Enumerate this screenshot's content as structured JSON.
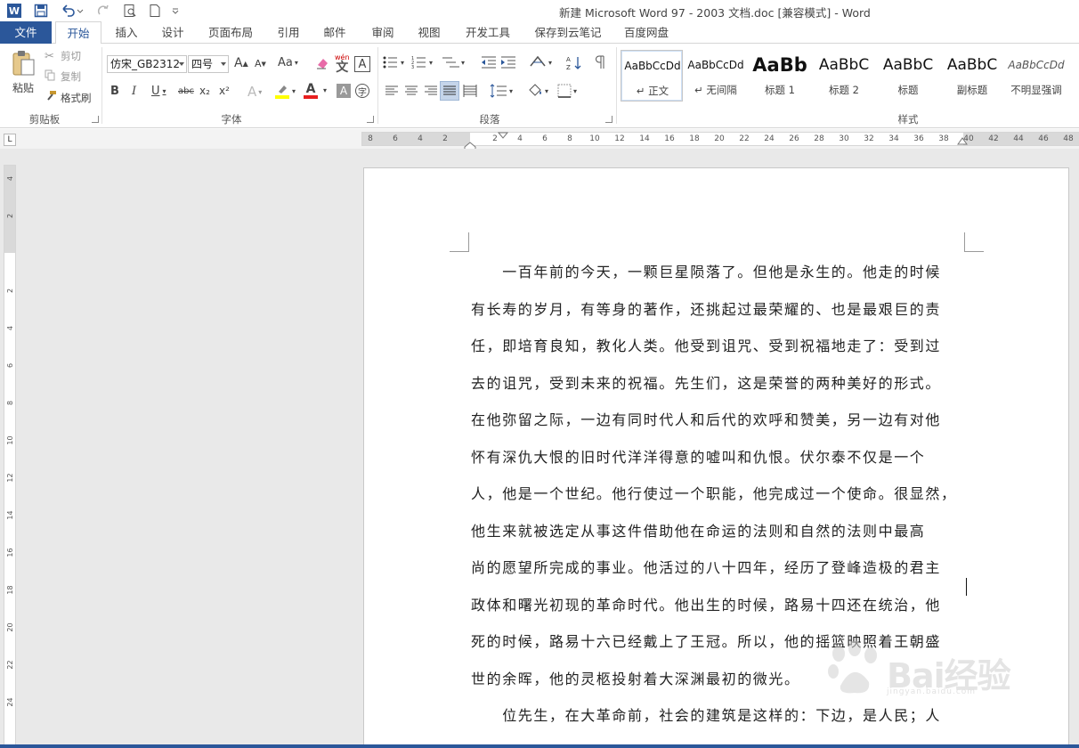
{
  "window": {
    "title": "新建 Microsoft Word 97 - 2003 文档.doc [兼容模式] - Word",
    "logo_letter": "W"
  },
  "tabs": [
    "文件",
    "开始",
    "插入",
    "设计",
    "页面布局",
    "引用",
    "邮件",
    "审阅",
    "视图",
    "开发工具",
    "保存到云笔记",
    "百度网盘"
  ],
  "active_tab": "开始",
  "clipboard": {
    "paste": "粘贴",
    "cut": "剪切",
    "copy": "复制",
    "format_painter": "格式刷",
    "group": "剪贴板"
  },
  "font": {
    "name": "仿宋_GB2312",
    "size": "四号",
    "case_button": "Aa",
    "phonetic": "wén",
    "char_border": "A",
    "group": "字体",
    "bold": "B",
    "italic": "I",
    "underline": "U",
    "strike": "abc",
    "subscript": "x₂",
    "superscript": "x²",
    "grow": "A",
    "shrink": "A"
  },
  "paragraph": {
    "group": "段落"
  },
  "styles": {
    "group": "样式",
    "items": [
      {
        "preview": "AaBbCcDd",
        "name": "↵ 正文"
      },
      {
        "preview": "AaBbCcDd",
        "name": "↵ 无间隔"
      },
      {
        "preview": "AaBb",
        "name": "标题 1"
      },
      {
        "preview": "AaBbC",
        "name": "标题 2"
      },
      {
        "preview": "AaBbC",
        "name": "标题"
      },
      {
        "preview": "AaBbC",
        "name": "副标题"
      },
      {
        "preview": "AaBbCcDd",
        "name": "不明显强调"
      }
    ]
  },
  "ruler": {
    "tab_selector": "L",
    "h_ticks": [
      "8",
      "6",
      "4",
      "2",
      "",
      "2",
      "4",
      "6",
      "8",
      "10",
      "12",
      "14",
      "16",
      "18",
      "20",
      "22",
      "24",
      "26",
      "28",
      "30",
      "32",
      "34",
      "36",
      "38",
      "40",
      "42",
      "44",
      "46",
      "48"
    ],
    "v_ticks": [
      "4",
      "2",
      "",
      "2",
      "4",
      "6",
      "8",
      "10",
      "12",
      "14",
      "16",
      "18",
      "20",
      "22",
      "24"
    ]
  },
  "document": {
    "lines": [
      "　　一百年前的今天，一颗巨星陨落了。但他是永生的。他走的时候",
      "有长寿的岁月，有等身的著作，还挑起过最荣耀的、也是最艰巨的责",
      "任，即培育良知，教化人类。他受到诅咒、受到祝福地走了：受到过",
      "去的诅咒，受到未来的祝福。先生们，这是荣誉的两种美好的形式。",
      "在他弥留之际，一边有同时代人和后代的欢呼和赞美，另一边有对他",
      "怀有深仇大恨的旧时代洋洋得意的嘘叫和仇恨。伏尔泰不仅是一个",
      "人，他是一个世纪。他行使过一个职能，他完成过一个使命。很显然，",
      "他生来就被选定从事这件借助他在命运的法则和自然的法则中最高",
      "尚的愿望所完成的事业。他活过的八十四年，经历了登峰造极的君主",
      "政体和曙光初现的革命时代。他出生的时候，路易十四还在统治，他",
      "死的时候，路易十六已经戴上了王冠。所以，他的摇篮映照着王朝盛",
      "世的余晖，他的灵柩投射着大深渊最初的微光。",
      "　　位先生，在大革命前，社会的建筑是这样的：下边，是人民；人"
    ]
  },
  "watermark": {
    "text": "Bai经验",
    "sub": "jingyan.baidu.com"
  }
}
